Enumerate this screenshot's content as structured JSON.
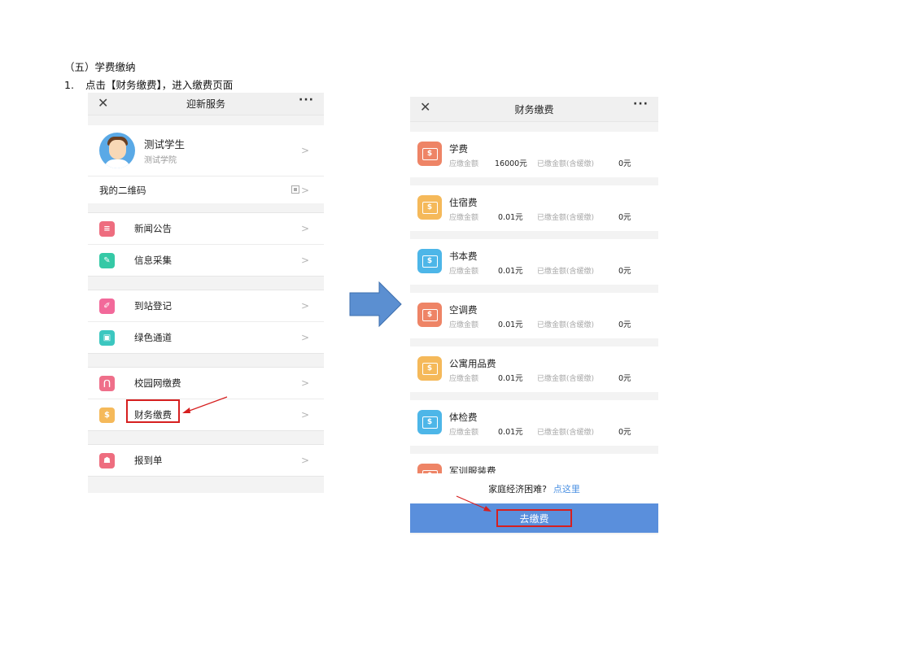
{
  "doc": {
    "heading": "（五）学费缴纳",
    "step_number": "1.",
    "step_text": "点击【财务缴费】，进入缴费页面"
  },
  "phone1": {
    "close_glyph": "✕",
    "title": "迎新服务",
    "more_glyph": "···",
    "profile": {
      "name": "测试学生",
      "school": "测试学院"
    },
    "qr_label": "我的二维码",
    "groups": [
      [
        {
          "label": "新闻公告",
          "icon": "document-icon",
          "color": "#ee6d7f"
        },
        {
          "label": "信息采集",
          "icon": "picture-icon",
          "color": "#35c9a6"
        }
      ],
      [
        {
          "label": "到站登记",
          "icon": "pencil-icon",
          "color": "#f2699a"
        },
        {
          "label": "绿色通道",
          "icon": "box-icon",
          "color": "#3cc7c0"
        }
      ],
      [
        {
          "label": "校园网缴费",
          "icon": "network-icon",
          "color": "#ef6f8a"
        },
        {
          "label": "财务缴费",
          "icon": "dollar-icon",
          "color": "#f5b95a"
        }
      ],
      [
        {
          "label": "报到单",
          "icon": "contact-card-icon",
          "color": "#ee6d7f"
        }
      ]
    ]
  },
  "phone2": {
    "close_glyph": "✕",
    "title": "财务缴费",
    "more_glyph": "···",
    "due_label": "应缴金额",
    "paid_label": "已缴金额(含缓缴)",
    "fees": [
      {
        "name": "学费",
        "due": "16000元",
        "paid": "0元",
        "color": "#ee8466"
      },
      {
        "name": "住宿费",
        "due": "0.01元",
        "paid": "0元",
        "color": "#f5b95a"
      },
      {
        "name": "书本费",
        "due": "0.01元",
        "paid": "0元",
        "color": "#4db6e8"
      },
      {
        "name": "空调费",
        "due": "0.01元",
        "paid": "0元",
        "color": "#ee8466"
      },
      {
        "name": "公寓用品费",
        "due": "0.01元",
        "paid": "0元",
        "color": "#f5b95a"
      },
      {
        "name": "体检费",
        "due": "0.01元",
        "paid": "0元",
        "color": "#4db6e8"
      },
      {
        "name": "军训服装费",
        "due": "",
        "paid": "",
        "color": "#ee8466"
      }
    ],
    "help_text": "家庭经济困难?",
    "help_link": "点这里",
    "pay_button": "去缴费"
  },
  "colors": {
    "arrow": "#5b8fd1",
    "highlight": "#d61f1f",
    "pay_button": "#5a8fdc"
  }
}
